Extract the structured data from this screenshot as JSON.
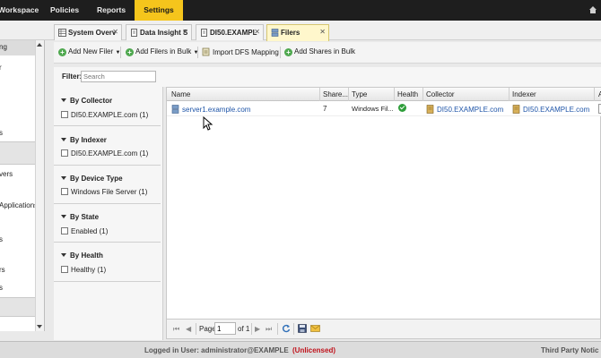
{
  "topnav": {
    "tabs": [
      "Workspace",
      "Policies",
      "Reports",
      "Settings"
    ],
    "active": "Settings"
  },
  "leftnav": {
    "items": [
      "ng",
      "r",
      "s",
      "vers",
      "Applications",
      "s",
      "rs",
      "s"
    ]
  },
  "doc_tabs": [
    {
      "label": "System Overv",
      "close": "✕"
    },
    {
      "label": "Data Insight S",
      "close": "✕"
    },
    {
      "label": "DI50.EXAMPL",
      "close": "✕"
    },
    {
      "label": "Filers",
      "close": "✕"
    }
  ],
  "toolbar": {
    "add_new_filer": "Add New Filer",
    "add_filers_bulk": "Add Filers in Bulk",
    "import_dfs": "Import DFS Mapping",
    "add_shares_bulk": "Add Shares in Bulk"
  },
  "filter": {
    "label": "Filter:",
    "placeholder": "Search"
  },
  "facets": [
    {
      "title": "By Collector",
      "option": "DI50.EXAMPLE.com (1)"
    },
    {
      "title": "By Indexer",
      "option": "DI50.EXAMPLE.com (1)"
    },
    {
      "title": "By Device Type",
      "option": "Windows File Server (1)"
    },
    {
      "title": "By State",
      "option": "Enabled (1)"
    },
    {
      "title": "By Health",
      "option": "Healthy (1)"
    }
  ],
  "grid": {
    "columns": [
      "Name",
      "Share...",
      "Type",
      "Health",
      "Collector",
      "Indexer",
      "A"
    ],
    "rows": [
      {
        "name": "server1.example.com",
        "shares": "7",
        "type": "Windows Fil...",
        "health": "healthy",
        "collector": "DI50.EXAMPLE.com",
        "indexer": "DI50.EXAMPLE.com"
      }
    ]
  },
  "pager": {
    "page_label": "Page",
    "page_value": "1",
    "of_label": "of 1"
  },
  "status": {
    "logged_in": "Logged in User: administrator@EXAMPLE",
    "license": "(Unlicensed)",
    "third_party": "Third Party Notic"
  },
  "colors": {
    "accent": "#f5c51c",
    "nav_bg": "#1e1e1e",
    "link": "#1f55a8",
    "healthy": "#2e9e3a",
    "warning": "#c0121b"
  }
}
